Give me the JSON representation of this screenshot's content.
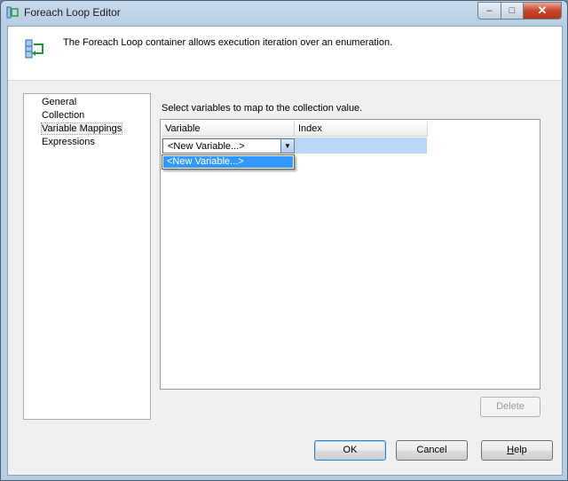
{
  "window": {
    "title": "Foreach Loop Editor",
    "buttons": {
      "minimize": "–",
      "maximize": "□",
      "close": "✕"
    }
  },
  "header": {
    "description": "The Foreach Loop container allows execution iteration over an enumeration."
  },
  "nav": {
    "items": [
      {
        "label": "General"
      },
      {
        "label": "Collection"
      },
      {
        "label": "Variable Mappings",
        "selected": true
      },
      {
        "label": "Expressions"
      }
    ]
  },
  "main": {
    "instruction": "Select variables to map to the collection value.",
    "grid": {
      "columns": [
        "Variable",
        "Index"
      ],
      "rows": [
        {
          "variable": "<New Variable...>",
          "index": ""
        }
      ],
      "dropdown_options": [
        "<New Variable...>"
      ]
    },
    "delete_label": "Delete"
  },
  "footer": {
    "ok_label": "OK",
    "cancel_label": "Cancel",
    "help_label_prefix": "",
    "help_label_accel": "H",
    "help_label_rest": "elp"
  },
  "colors": {
    "selection": "#3399ff",
    "row_highlight": "#b9d6f7",
    "close_button": "#c9452b"
  }
}
